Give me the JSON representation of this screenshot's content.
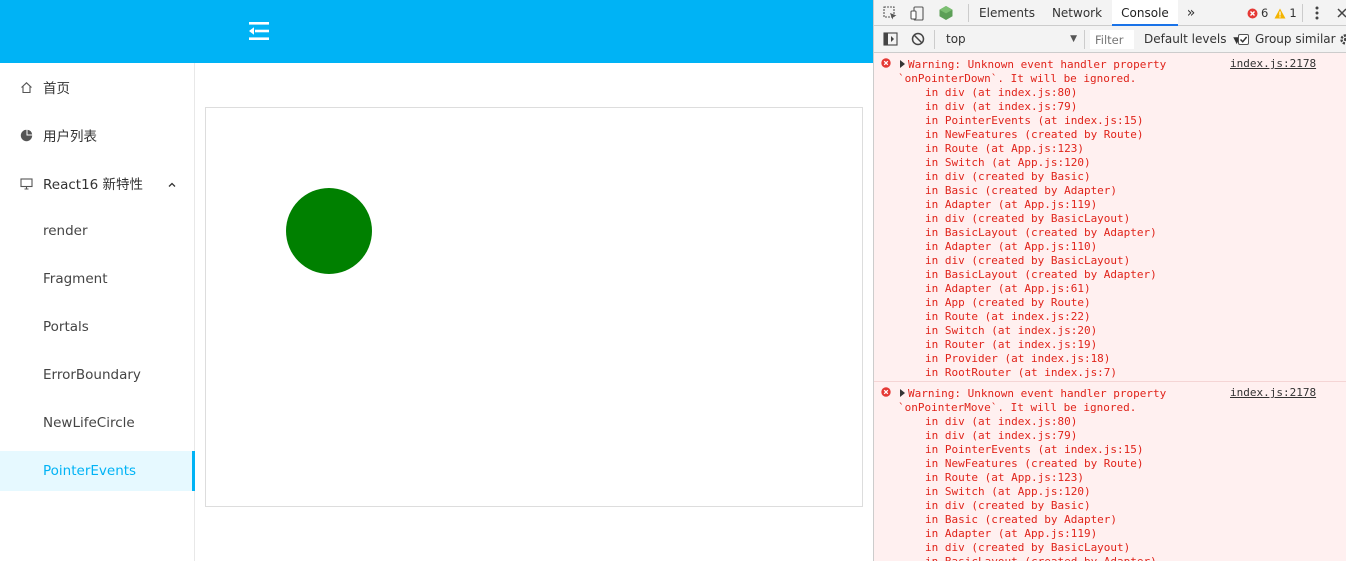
{
  "app": {
    "menu": [
      {
        "label": "首页",
        "icon": "home-icon"
      },
      {
        "label": "用户列表",
        "icon": "pie-chart-icon"
      },
      {
        "label": "React16 新特性",
        "icon": "desktop-icon",
        "expanded": true
      }
    ],
    "submenu": [
      {
        "label": "render"
      },
      {
        "label": "Fragment"
      },
      {
        "label": "Portals"
      },
      {
        "label": "ErrorBoundary"
      },
      {
        "label": "NewLifeCircle"
      },
      {
        "label": "PointerEvents",
        "active": true
      }
    ],
    "colors": {
      "header": "#00b3f5",
      "accent": "#00b3f5",
      "circle": "#008000"
    }
  },
  "devtools": {
    "tabs": [
      "Elements",
      "Network",
      "Console"
    ],
    "active_tab": "Console",
    "more_tabs_icon": "chevrons-right-icon",
    "error_count": "6",
    "warning_count": "1",
    "context": "top",
    "filter_placeholder": "Filter",
    "levels_label": "Default levels",
    "group_similar_label": "Group similar",
    "group_similar_checked": true,
    "messages": [
      {
        "source": "index.js:2178",
        "text": [
          "Warning: Unknown event handler property",
          "`onPointerDown`. It will be ignored."
        ],
        "stack": [
          "in div (at index.js:80)",
          "in div (at index.js:79)",
          "in PointerEvents (at index.js:15)",
          "in NewFeatures (created by Route)",
          "in Route (at App.js:123)",
          "in Switch (at App.js:120)",
          "in div (created by Basic)",
          "in Basic (created by Adapter)",
          "in Adapter (at App.js:119)",
          "in div (created by BasicLayout)",
          "in BasicLayout (created by Adapter)",
          "in Adapter (at App.js:110)",
          "in div (created by BasicLayout)",
          "in BasicLayout (created by Adapter)",
          "in Adapter (at App.js:61)",
          "in App (created by Route)",
          "in Route (at index.js:22)",
          "in Switch (at index.js:20)",
          "in Router (at index.js:19)",
          "in Provider (at index.js:18)",
          "in RootRouter (at index.js:7)"
        ]
      },
      {
        "source": "index.js:2178",
        "text": [
          "Warning: Unknown event handler property",
          "`onPointerMove`. It will be ignored."
        ],
        "stack": [
          "in div (at index.js:80)",
          "in div (at index.js:79)",
          "in PointerEvents (at index.js:15)",
          "in NewFeatures (created by Route)",
          "in Route (at App.js:123)",
          "in Switch (at App.js:120)",
          "in div (created by Basic)",
          "in Basic (created by Adapter)",
          "in Adapter (at App.js:119)",
          "in div (created by BasicLayout)",
          "in BasicLayout (created by Adapter)"
        ]
      }
    ]
  }
}
